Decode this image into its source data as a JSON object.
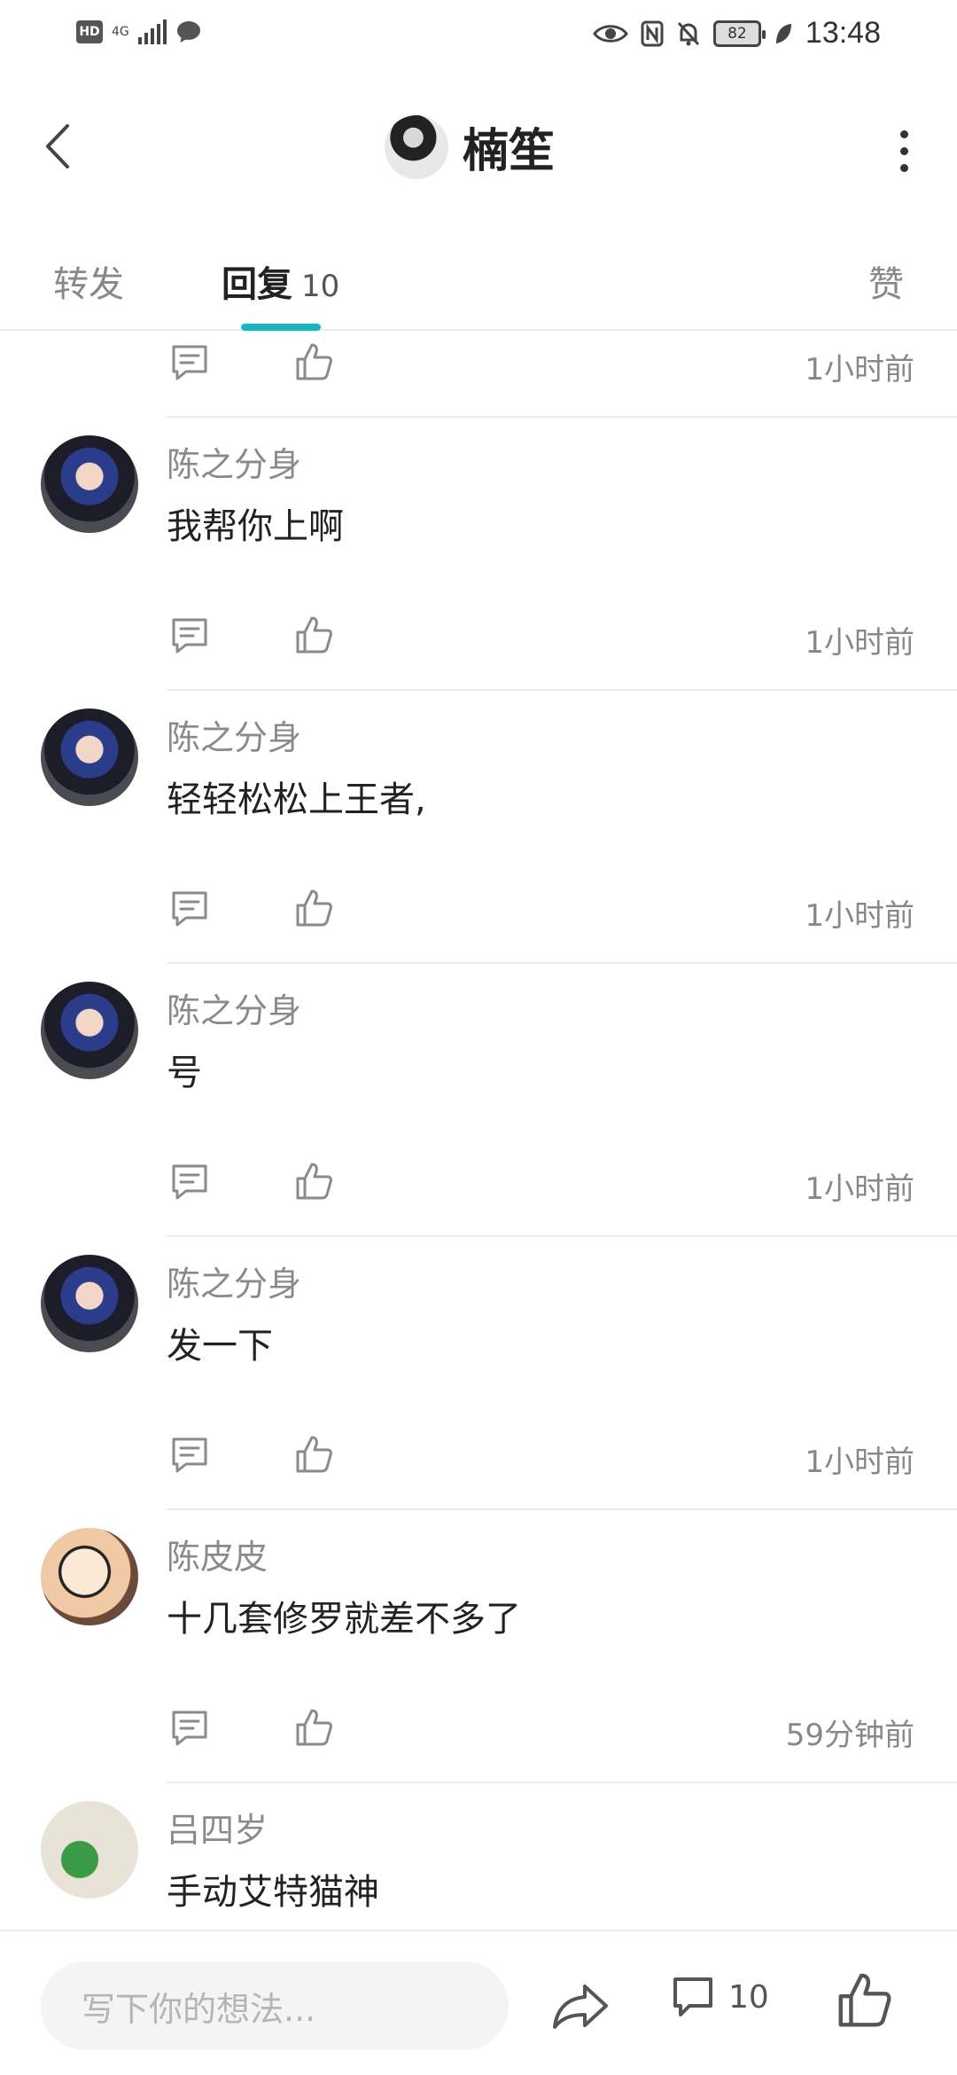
{
  "status_bar": {
    "hd": "HD",
    "network": "4G",
    "battery": "82",
    "time": "13:48"
  },
  "header": {
    "title": "楠笙"
  },
  "tabs": {
    "forward": "转发",
    "reply": "回复",
    "reply_count": "10",
    "like": "赞"
  },
  "comments": [
    {
      "name": "",
      "text": "",
      "time": "1小时前"
    },
    {
      "name": "陈之分身",
      "text": "我帮你上啊",
      "time": "1小时前"
    },
    {
      "name": "陈之分身",
      "text": "轻轻松松上王者,",
      "time": "1小时前"
    },
    {
      "name": "陈之分身",
      "text": "号",
      "time": "1小时前"
    },
    {
      "name": "陈之分身",
      "text": "发一下",
      "time": "1小时前"
    },
    {
      "name": "陈皮皮",
      "text": "十几套修罗就差不多了",
      "time": "59分钟前"
    },
    {
      "name": "吕四岁",
      "text": "手动艾特猫神",
      "time": ""
    }
  ],
  "bottom_bar": {
    "input_placeholder": "写下你的想法...",
    "comment_count": "10"
  },
  "colors": {
    "accent": "#16b6c1",
    "text_primary": "#222222",
    "text_secondary": "#8a8a8a",
    "divider": "#ececec"
  },
  "icons": [
    "back-arrow-icon",
    "more-vertical-icon",
    "reply-icon",
    "like-icon",
    "share-icon",
    "comment-icon"
  ]
}
